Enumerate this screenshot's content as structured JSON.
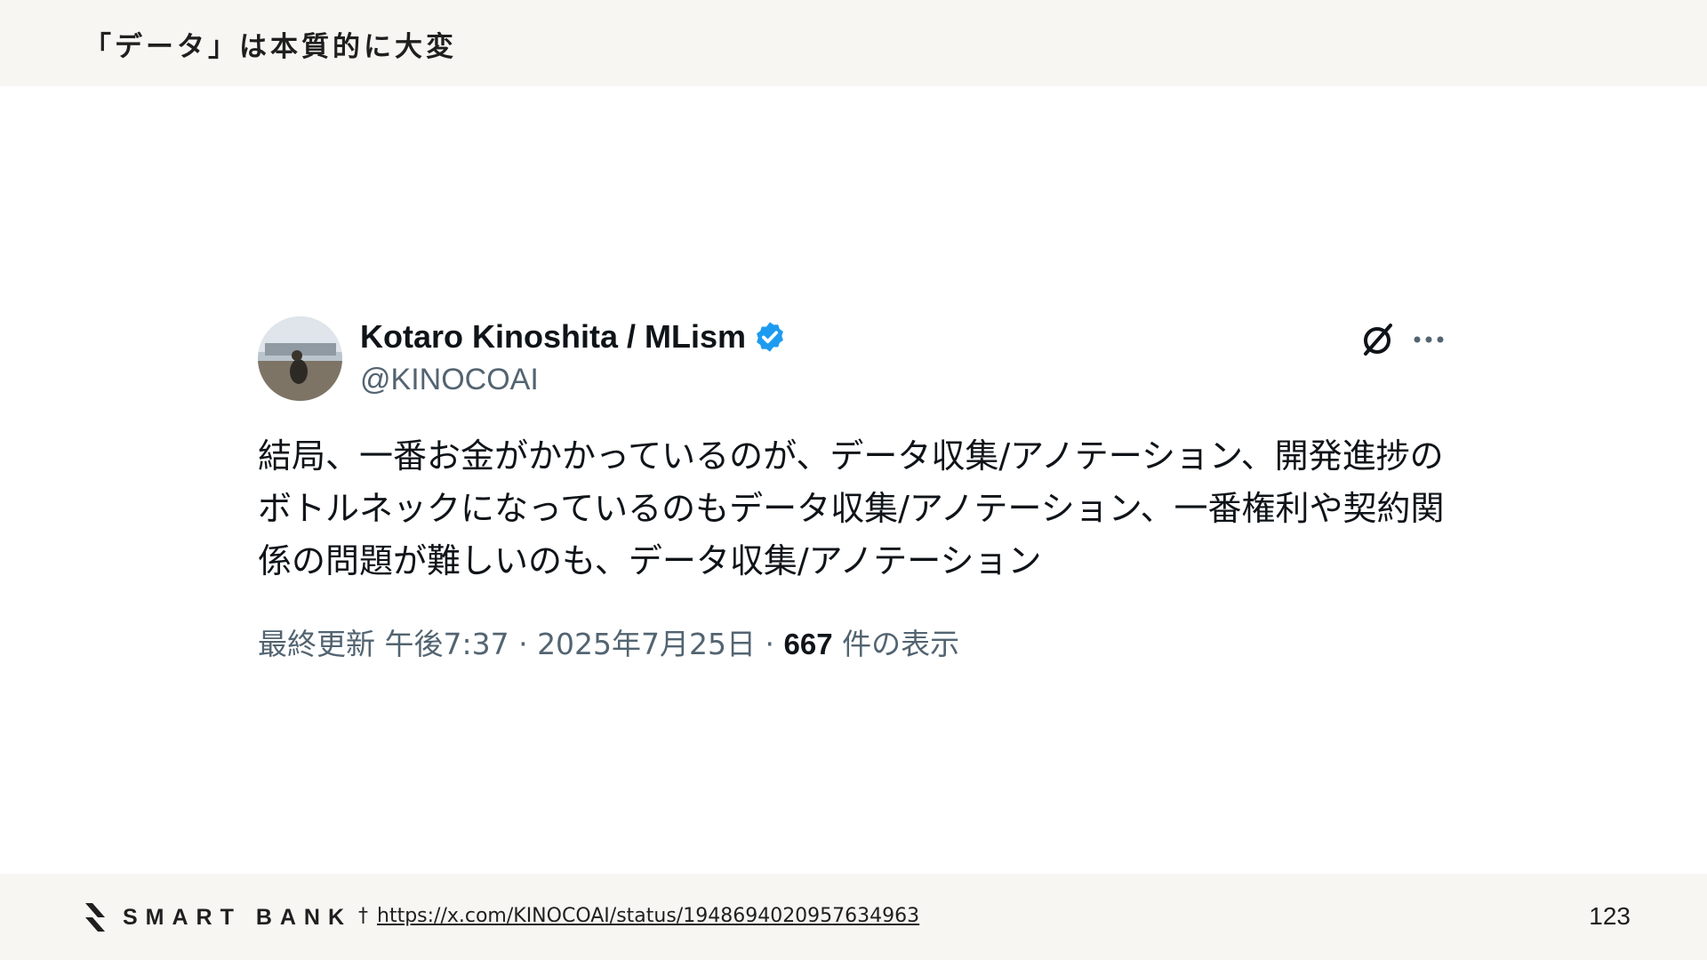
{
  "slide": {
    "title": "「データ」は本質的に大変",
    "page_number": "123"
  },
  "tweet": {
    "author_name": "Kotaro Kinoshita / MLism",
    "handle": "@KINOCOAI",
    "verified_icon": "verified-badge-icon",
    "text": "結局、一番お金がかかっているのが、データ収集/アノテーション、開発進捗のボトルネックになっているのもデータ収集/アノテーション、一番権利や契約関係の問題が難しいのも、データ収集/アノテーション",
    "meta": {
      "edited_time": "最終更新 午後7:37 · 2025年7月25日 · ",
      "views_count": "667",
      "views_label": " 件の表示"
    },
    "icons": {
      "grok": "grok-icon",
      "more": "more-options-icon"
    }
  },
  "footer": {
    "logo_text": "SMART BANK",
    "dagger": "†",
    "source_url": "https://x.com/KINOCOAI/status/1948694020957634963"
  },
  "colors": {
    "band": "#f7f6f2",
    "verified": "#1d9bf0",
    "muted": "#536471",
    "text": "#0f1419"
  }
}
